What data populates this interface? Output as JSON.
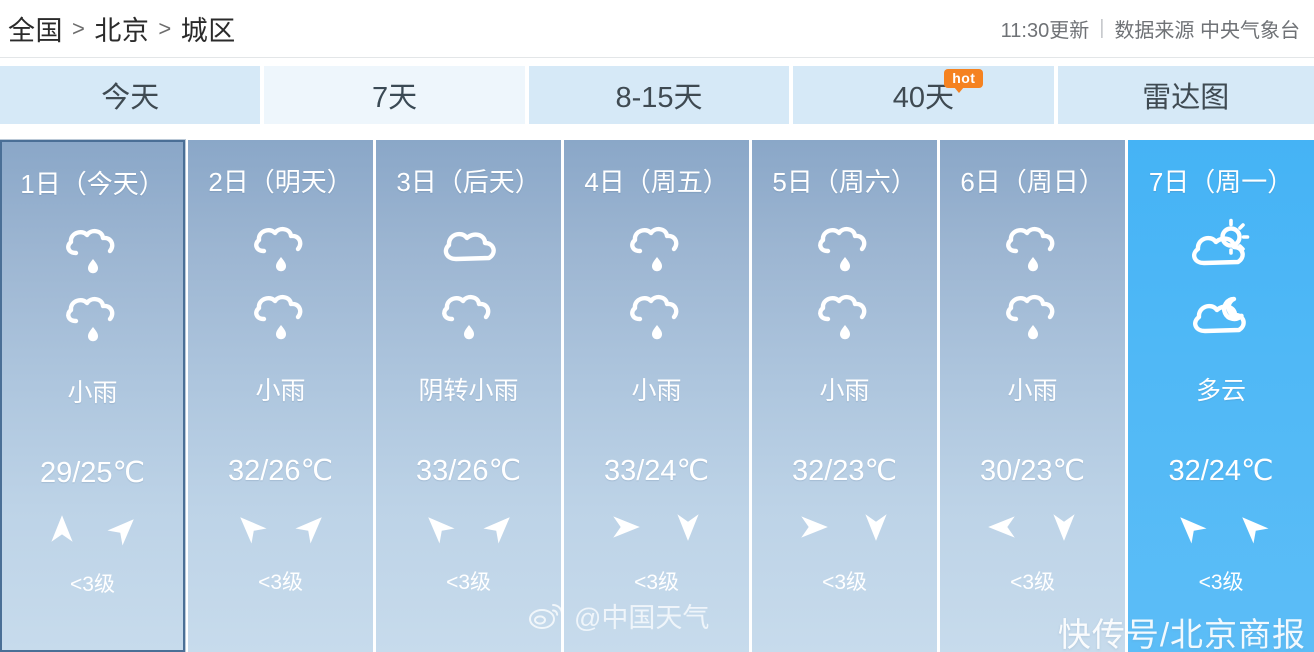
{
  "header": {
    "breadcrumb": [
      "全国",
      "北京",
      "城区"
    ],
    "separator": ">",
    "update_time": "11:30更新",
    "meta_separator": "|",
    "data_source": "数据来源 中央气象台"
  },
  "tabs": [
    {
      "label": "今天",
      "selected": false
    },
    {
      "label": "7天",
      "selected": true
    },
    {
      "label": "8-15天",
      "selected": false
    },
    {
      "label": "40天",
      "selected": false,
      "badge": "hot"
    },
    {
      "label": "雷达图",
      "selected": false
    }
  ],
  "forecast": {
    "wind_level_label": "<3级",
    "days": [
      {
        "title": "1日（今天）",
        "day_icon": "rain-cloud-icon",
        "night_icon": "rain-cloud-icon",
        "condition": "小雨",
        "temp": "29/25℃",
        "high": 29,
        "low": 25,
        "wind_day_dir": "up",
        "wind_night_dir": "up-right",
        "wind": "<3级",
        "selected": true,
        "highlight": false
      },
      {
        "title": "2日（明天）",
        "day_icon": "rain-cloud-icon",
        "night_icon": "rain-cloud-icon",
        "condition": "小雨",
        "temp": "32/26℃",
        "high": 32,
        "low": 26,
        "wind_day_dir": "up-left",
        "wind_night_dir": "up-right",
        "wind": "<3级",
        "selected": false,
        "highlight": false
      },
      {
        "title": "3日（后天）",
        "day_icon": "overcast-cloud-icon",
        "night_icon": "rain-cloud-icon",
        "condition": "阴转小雨",
        "temp": "33/26℃",
        "high": 33,
        "low": 26,
        "wind_day_dir": "up-left",
        "wind_night_dir": "up-right",
        "wind": "<3级",
        "selected": false,
        "highlight": false
      },
      {
        "title": "4日（周五）",
        "day_icon": "rain-cloud-icon",
        "night_icon": "rain-cloud-icon",
        "condition": "小雨",
        "temp": "33/24℃",
        "high": 33,
        "low": 24,
        "wind_day_dir": "right",
        "wind_night_dir": "down",
        "wind": "<3级",
        "selected": false,
        "highlight": false
      },
      {
        "title": "5日（周六）",
        "day_icon": "rain-cloud-icon",
        "night_icon": "rain-cloud-icon",
        "condition": "小雨",
        "temp": "32/23℃",
        "high": 32,
        "low": 23,
        "wind_day_dir": "right",
        "wind_night_dir": "down",
        "wind": "<3级",
        "selected": false,
        "highlight": false
      },
      {
        "title": "6日（周日）",
        "day_icon": "rain-cloud-icon",
        "night_icon": "rain-cloud-icon",
        "condition": "小雨",
        "temp": "30/23℃",
        "high": 30,
        "low": 23,
        "wind_day_dir": "left",
        "wind_night_dir": "down",
        "wind": "<3级",
        "selected": false,
        "highlight": false
      },
      {
        "title": "7日（周一）",
        "day_icon": "sun-behind-cloud-icon",
        "night_icon": "moon-behind-cloud-icon",
        "condition": "多云",
        "temp": "32/24℃",
        "high": 32,
        "low": 24,
        "wind_day_dir": "up-left",
        "wind_night_dir": "up-left",
        "wind": "<3级",
        "selected": false,
        "highlight": true
      }
    ]
  },
  "watermarks": {
    "weibo_handle": "@中国天气",
    "publisher": "快传号/北京商报"
  },
  "colors": {
    "tab_default_bg": "#d6e9f7",
    "tab_selected_bg": "#eef6fc",
    "badge_orange": "#f58220",
    "card_top": "#8aa7c8",
    "card_bottom": "#c7dbec",
    "highlight_blue": "#4fb8f6",
    "selected_border": "#4a6f96"
  }
}
